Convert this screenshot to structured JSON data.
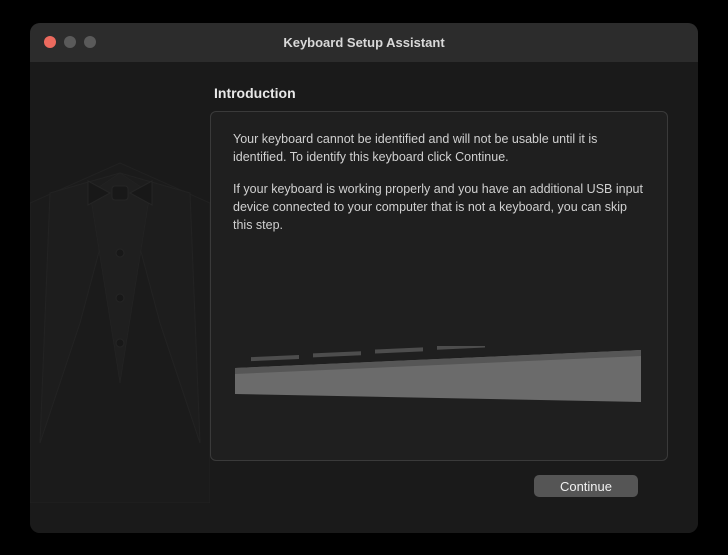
{
  "window": {
    "title": "Keyboard Setup Assistant"
  },
  "section": {
    "title": "Introduction"
  },
  "content": {
    "paragraph1": "Your keyboard cannot be identified and will not be usable until it is identified. To identify this keyboard click Continue.",
    "paragraph2": "If your keyboard is working properly and you have an additional USB input device connected to your computer that is not a keyboard, you can skip this step."
  },
  "buttons": {
    "continue": "Continue"
  },
  "colors": {
    "window_bg": "#1a1a1a",
    "titlebar_bg": "#2c2c2c",
    "panel_border": "#3a3a3a",
    "text": "#d0d0d0",
    "button_bg": "#555"
  }
}
